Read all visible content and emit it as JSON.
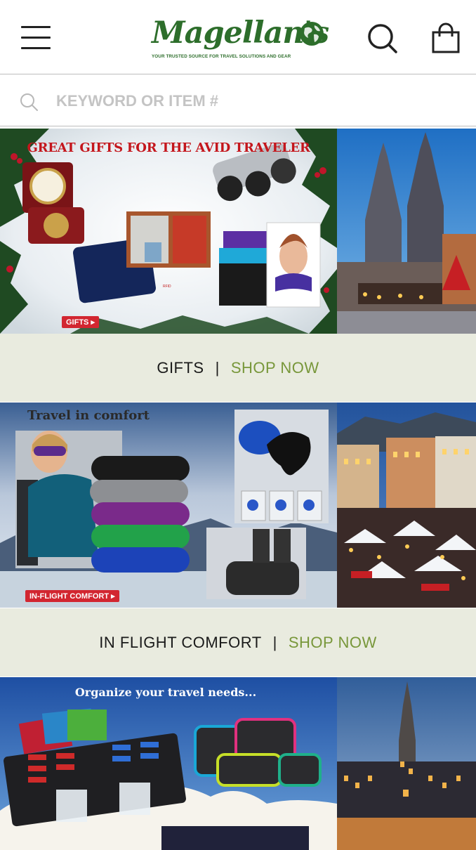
{
  "header": {
    "logo_text": "Magellan's",
    "logo_tagline": "YOUR TRUSTED SOURCE FOR TRAVEL SOLUTIONS AND GEAR"
  },
  "search": {
    "placeholder": "KEYWORD OR ITEM #"
  },
  "banners": [
    {
      "headline": "GREAT GIFTS FOR THE AVID TRAVELER",
      "badge": "GIFTS ▸",
      "rfid": "RFID BLOCKING",
      "cta_label": "GIFTS",
      "cta_separator": "|",
      "cta_link": "SHOP NOW"
    },
    {
      "headline": "Travel in comfort",
      "badge": "IN-FLIGHT COMFORT ▸",
      "cta_label": "IN FLIGHT COMFORT",
      "cta_separator": "|",
      "cta_link": "SHOP NOW"
    },
    {
      "headline": "Organize your travel needs..."
    }
  ],
  "colors": {
    "brand_green": "#2d6e2b",
    "cta_green": "#78973a",
    "strip_bg": "#e9ebdf"
  }
}
